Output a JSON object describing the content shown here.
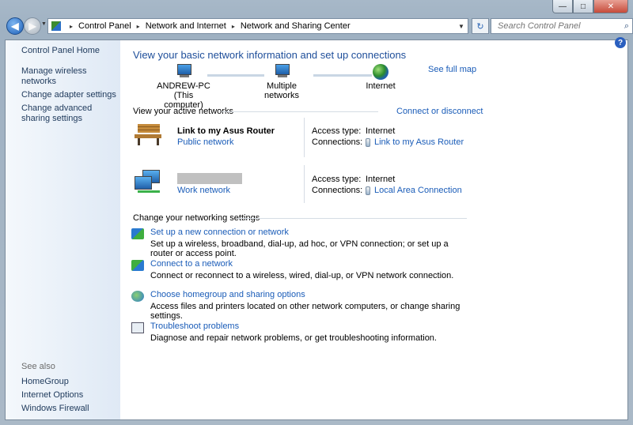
{
  "window": {
    "caption_minimize": "—",
    "caption_maximize": "□",
    "caption_close": "✕"
  },
  "address": {
    "crumbs": [
      "Control Panel",
      "Network and Internet",
      "Network and Sharing Center"
    ],
    "separator": "▸",
    "search_placeholder": "Search Control Panel"
  },
  "sidebar": {
    "home": "Control Panel Home",
    "items": [
      "Manage wireless networks",
      "Change adapter settings",
      "Change advanced sharing settings"
    ],
    "see_also_title": "See also",
    "see_also": [
      "HomeGroup",
      "Internet Options",
      "Windows Firewall"
    ]
  },
  "main": {
    "title": "View your basic network information and set up connections",
    "see_full_map": "See full map",
    "nodes": {
      "computer_name": "ANDREW-PC",
      "computer_sub": "(This computer)",
      "multiple": "Multiple networks",
      "internet": "Internet"
    },
    "active_networks_label": "View your active networks",
    "connect_or_disconnect": "Connect or disconnect",
    "networks": [
      {
        "name": "Link to my Asus Router",
        "type": "Public network",
        "access_label": "Access type:",
        "access_value": "Internet",
        "connections_label": "Connections:",
        "connection": "Link to my Asus Router"
      },
      {
        "name": "",
        "type": "Work network",
        "access_label": "Access type:",
        "access_value": "Internet",
        "connections_label": "Connections:",
        "connection": "Local Area Connection"
      }
    ],
    "change_settings_label": "Change your networking settings",
    "tasks": [
      {
        "title": "Set up a new connection or network",
        "desc": "Set up a wireless, broadband, dial-up, ad hoc, or VPN connection; or set up a router or access point."
      },
      {
        "title": "Connect to a network",
        "desc": "Connect or reconnect to a wireless, wired, dial-up, or VPN network connection."
      },
      {
        "title": "Choose homegroup and sharing options",
        "desc": "Access files and printers located on other network computers, or change sharing settings."
      },
      {
        "title": "Troubleshoot problems",
        "desc": "Diagnose and repair network problems, or get troubleshooting information."
      }
    ]
  }
}
